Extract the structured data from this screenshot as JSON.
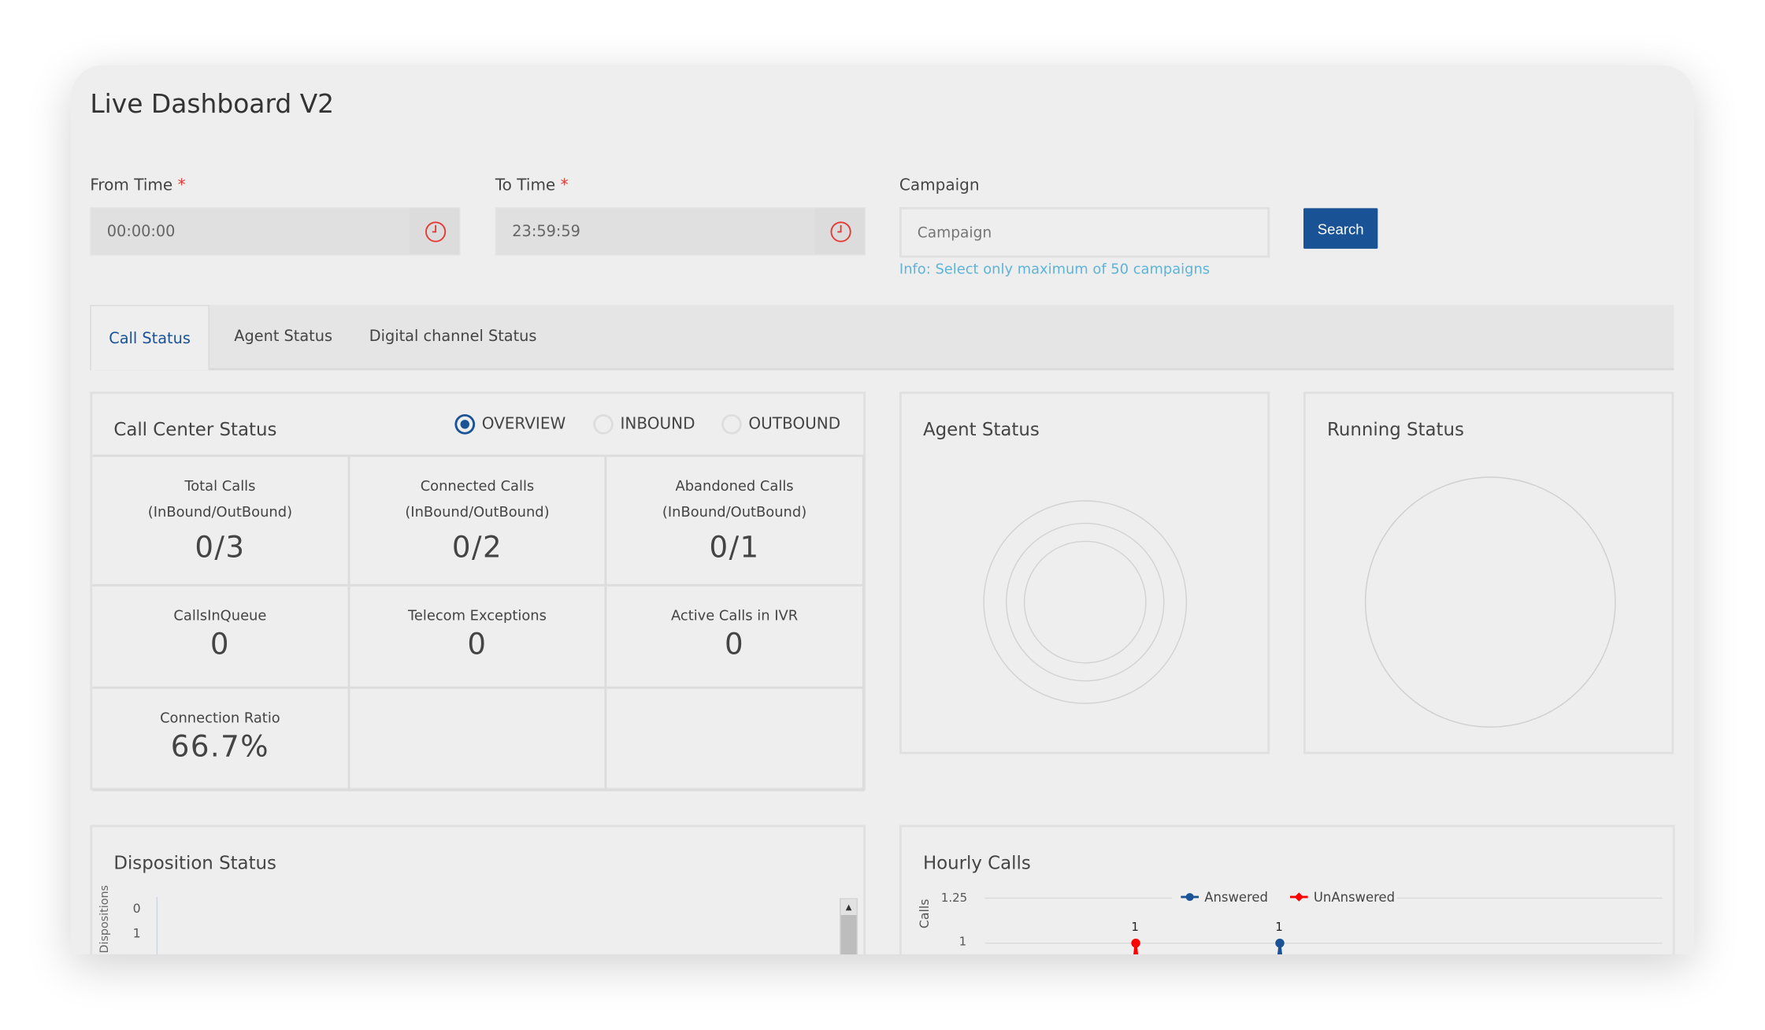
{
  "page": {
    "title": "Live Dashboard V2"
  },
  "filters": {
    "from_time": {
      "label": "From Time",
      "required_mark": "*",
      "value": "00:00:00",
      "icon": "clock-icon"
    },
    "to_time": {
      "label": "To Time",
      "required_mark": "*",
      "value": "23:59:59",
      "icon": "clock-icon"
    },
    "campaign": {
      "label": "Campaign",
      "placeholder": "Campaign",
      "value": "",
      "info": "Info: Select only maximum of 50 campaigns"
    },
    "search_label": "Search"
  },
  "tabs": [
    {
      "label": "Call Status",
      "active": true
    },
    {
      "label": "Agent Status",
      "active": false
    },
    {
      "label": "Digital channel Status",
      "active": false
    }
  ],
  "call_center": {
    "title": "Call Center Status",
    "modes": [
      {
        "label": "OVERVIEW",
        "selected": true
      },
      {
        "label": "INBOUND",
        "selected": false
      },
      {
        "label": "OUTBOUND",
        "selected": false
      }
    ],
    "metrics": [
      {
        "label1": "Total Calls",
        "label2": "(InBound/OutBound)",
        "value": "0/3"
      },
      {
        "label1": "Connected Calls",
        "label2": "(InBound/OutBound)",
        "value": "0/2"
      },
      {
        "label1": "Abandoned Calls",
        "label2": "(InBound/OutBound)",
        "value": "0/1"
      },
      {
        "label1": "CallsInQueue",
        "value": "0"
      },
      {
        "label1": "Telecom Exceptions",
        "value": "0"
      },
      {
        "label1": "Active Calls in IVR",
        "value": "0"
      },
      {
        "label1": "Connection Ratio",
        "value": "66.7%"
      }
    ]
  },
  "agent_status": {
    "title": "Agent Status"
  },
  "running_status": {
    "title": "Running Status"
  },
  "disposition": {
    "title": "Disposition Status",
    "y_axis_label": "Dispositions",
    "ticks": [
      "0",
      "1"
    ]
  },
  "hourly": {
    "title": "Hourly Calls"
  },
  "colors": {
    "accent": "#1a5296",
    "answered": "#1a5296",
    "unanswered": "#ff0000",
    "info": "#5fb3d6",
    "required": "#e53935"
  },
  "chart_data": {
    "type": "line",
    "ylabel": "Calls",
    "y_ticks": [
      "1.25",
      "1"
    ],
    "legend_placement": "top",
    "grid": true,
    "series": [
      {
        "name": "Answered",
        "color": "#1a5296",
        "points": [
          {
            "y": 1,
            "label": "1"
          }
        ]
      },
      {
        "name": "UnAnswered",
        "color": "#ff0000",
        "points": [
          {
            "y": 1,
            "label": "1"
          }
        ]
      }
    ]
  }
}
